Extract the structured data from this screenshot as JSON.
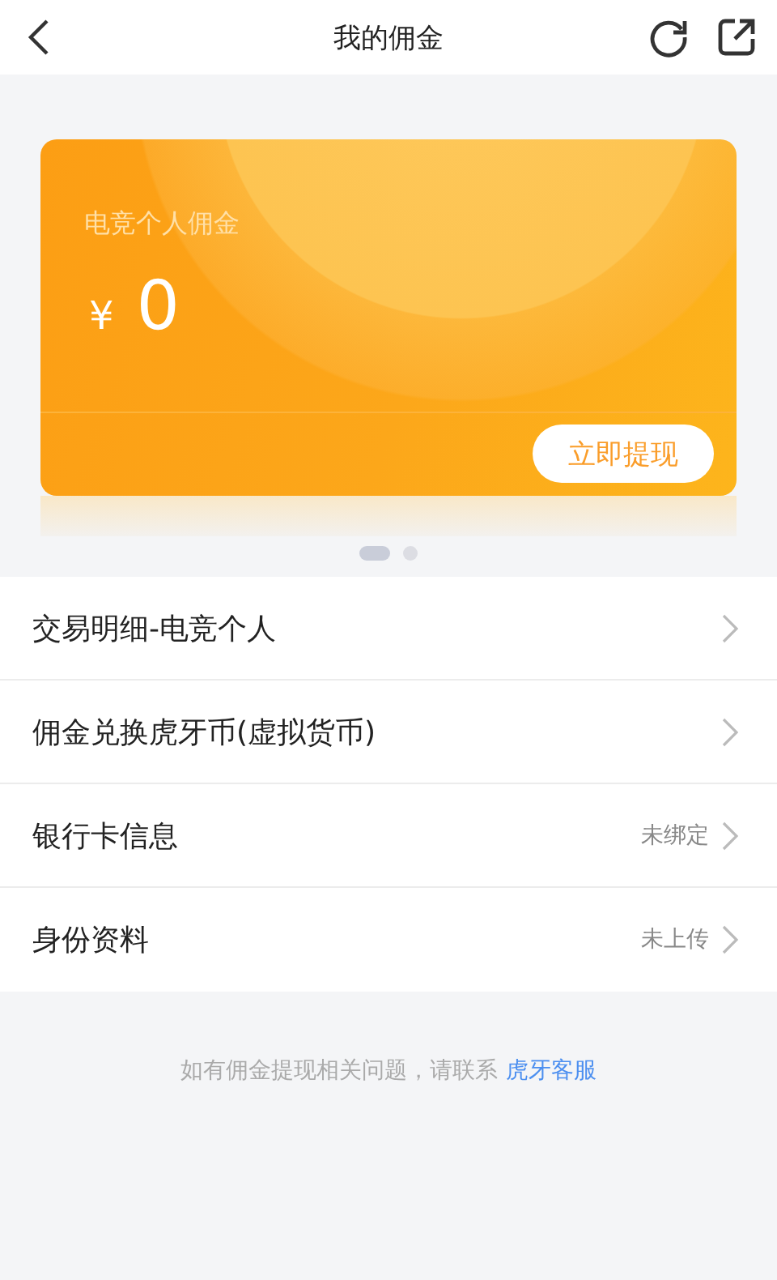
{
  "header": {
    "title": "我的佣金"
  },
  "card": {
    "label": "电竞个人佣金",
    "currency": "¥",
    "amount": "0",
    "button": "立即提现"
  },
  "pager": [
    {
      "selected": true
    },
    {
      "selected": false
    }
  ],
  "menu": [
    {
      "label": "交易明细-电竞个人"
    },
    {
      "label": "佣金兑换虎牙币(虚拟货币)"
    },
    {
      "label": "银行卡信息",
      "status": "未绑定"
    },
    {
      "label": "身份资料",
      "status": "未上传"
    }
  ],
  "footer": {
    "text": "如有佣金提现相关问题，请联系",
    "link": "虎牙客服"
  }
}
